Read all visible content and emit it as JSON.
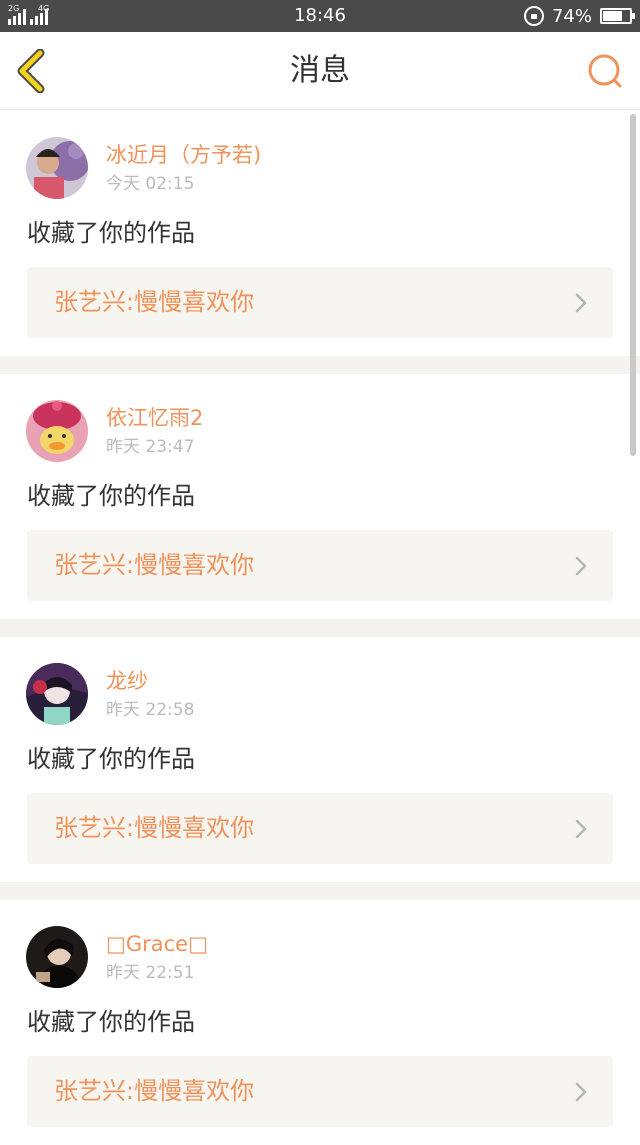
{
  "status_bar": {
    "network_label_1": "2G",
    "network_label_2": "4G",
    "time": "18:46",
    "battery_percent": "74%",
    "battery_level": 0.74
  },
  "header": {
    "title": "消息",
    "accent_color": "#f0925a"
  },
  "messages": [
    {
      "user": "冰近月（方予若)",
      "time": "今天 02:15",
      "action": "收藏了你的作品",
      "work": "张艺兴:慢慢喜欢你"
    },
    {
      "user": "依江忆雨2",
      "time": "昨天 23:47",
      "action": "收藏了你的作品",
      "work": "张艺兴:慢慢喜欢你"
    },
    {
      "user": "龙纱",
      "time": "昨天 22:58",
      "action": "收藏了你的作品",
      "work": "张艺兴:慢慢喜欢你"
    },
    {
      "user": "□Grace□",
      "time": "昨天 22:51",
      "action": "收藏了你的作品",
      "work": "张艺兴:慢慢喜欢你"
    }
  ]
}
